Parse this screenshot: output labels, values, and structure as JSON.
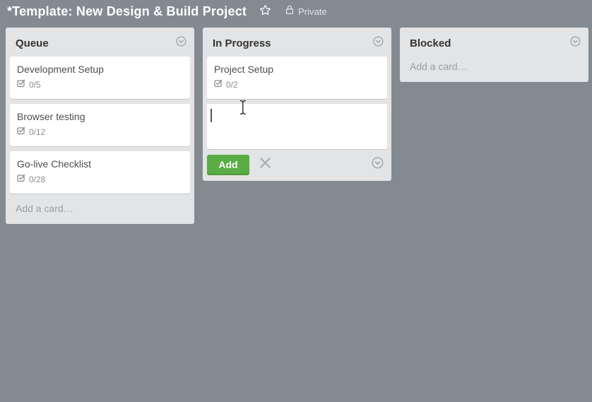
{
  "board": {
    "title": "*Template: New Design & Build Project",
    "visibility": "Private"
  },
  "lists": [
    {
      "name": "Queue",
      "cards": [
        {
          "title": "Development Setup",
          "checklist": "0/5"
        },
        {
          "title": "Browser testing",
          "checklist": "0/12"
        },
        {
          "title": "Go-live Checklist",
          "checklist": "0/28"
        }
      ],
      "add_card_label": "Add a card…"
    },
    {
      "name": "In Progress",
      "cards": [
        {
          "title": "Project Setup",
          "checklist": "0/2"
        }
      ],
      "composer": {
        "value": "",
        "add_label": "Add"
      }
    },
    {
      "name": "Blocked",
      "cards": [],
      "add_card_label": "Add a card…"
    }
  ],
  "icons": {
    "star": "outline-star",
    "lock": "padlock",
    "list_menu": "chevron-down-in-circle",
    "checklist": "checked-checkbox",
    "close": "x-cross",
    "mouse": "i-beam-text-cursor"
  },
  "colors": {
    "board_background": "#838a90",
    "list_background": "#e2e4e6",
    "card_background": "#ffffff",
    "card_shadow": "#c4c9cc",
    "add_button": "#5aac44",
    "add_button_shadow": "#519839",
    "board_title_text": "#ffffff",
    "list_title_text": "#333333",
    "card_title_text": "#4d4d4d",
    "muted_text": "#8c8c8c"
  }
}
